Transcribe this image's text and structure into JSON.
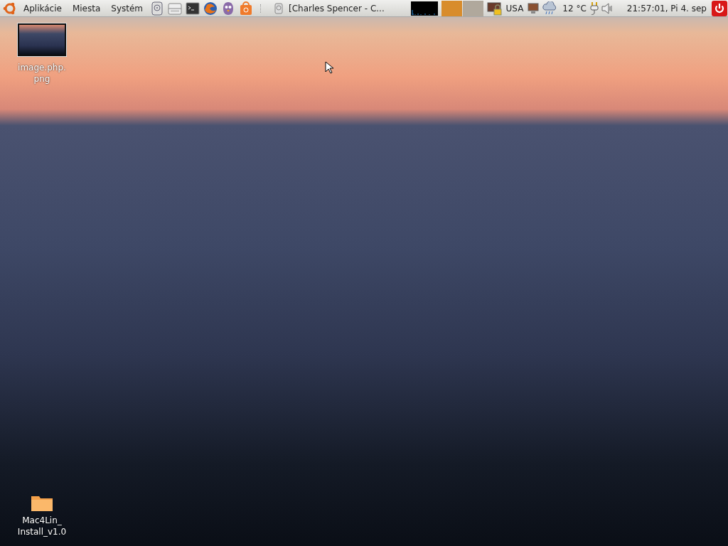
{
  "panel": {
    "menus": [
      "Aplikácie",
      "Miesta",
      "Systém"
    ],
    "launchers": [
      {
        "kind": "disk"
      },
      {
        "kind": "drive"
      },
      {
        "kind": "terminal"
      },
      {
        "kind": "browser"
      },
      {
        "kind": "chat"
      },
      {
        "kind": "store"
      }
    ],
    "tasks": [
      {
        "label": "[Charles Spencer - C...",
        "selected": false
      }
    ],
    "workspaces": [
      {
        "selected": true
      },
      {
        "selected": false
      }
    ],
    "keyboard_layout": "USA",
    "temperature": "12 °C",
    "clock": "21:57:01, Pi 4. sep"
  },
  "desktop_icons": [
    {
      "kind": "image",
      "lines": [
        "image.php.",
        "png"
      ]
    },
    {
      "kind": "folder",
      "lines": [
        "Mac4Lin_",
        "Install_v1.0"
      ]
    }
  ]
}
